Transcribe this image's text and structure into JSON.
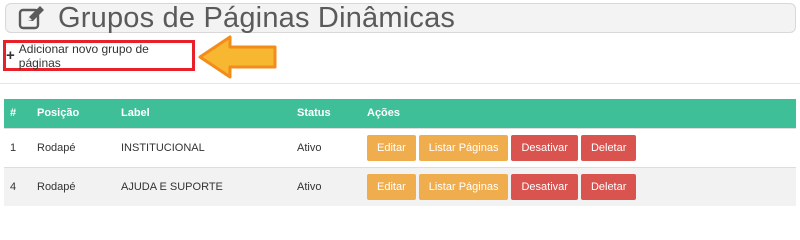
{
  "page": {
    "title": "Grupos de Páginas Dinâmicas",
    "add_button_label": "Adicionar novo grupo de páginas"
  },
  "table": {
    "headers": [
      "#",
      "Posição",
      "Label",
      "Status",
      "Ações"
    ],
    "rows": [
      {
        "id": "1",
        "position": "Rodapé",
        "label": "INSTITUCIONAL",
        "status": "Ativo"
      },
      {
        "id": "4",
        "position": "Rodapé",
        "label": "AJUDA E SUPORTE",
        "status": "Ativo"
      }
    ],
    "actions": {
      "edit": "Editar",
      "list": "Listar Páginas",
      "deactivate": "Desativar",
      "delete": "Deletar"
    }
  },
  "colors": {
    "header_bg": "#3fbf98",
    "warning": "#f0ad4e",
    "danger": "#d9534f",
    "highlight_border": "#e8202a",
    "arrow_fill": "#f7b731",
    "arrow_stroke": "#f28c1a"
  },
  "icons": {
    "title": "edit-icon",
    "add": "plus-icon",
    "annotation": "arrow-left-icon"
  }
}
